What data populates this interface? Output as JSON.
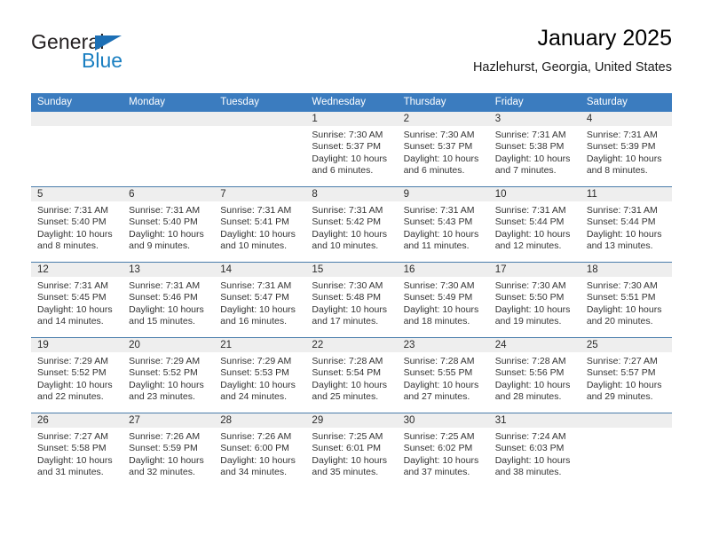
{
  "brand": {
    "name_part1": "General",
    "name_part2": "Blue",
    "accent_color": "#1c6fb5",
    "text_color": "#231f20"
  },
  "header": {
    "title": "January 2025",
    "location": "Hazlehurst, Georgia, United States"
  },
  "theme": {
    "header_row_bg": "#3b7cbf",
    "daynum_band_bg": "#eeeeee",
    "row_separator": "#4a7dab"
  },
  "weekday_headers": [
    "Sunday",
    "Monday",
    "Tuesday",
    "Wednesday",
    "Thursday",
    "Friday",
    "Saturday"
  ],
  "weeks": [
    [
      {
        "day": "",
        "sunrise": "",
        "sunset": "",
        "daylight_line1": "",
        "daylight_line2": "",
        "empty": true
      },
      {
        "day": "",
        "sunrise": "",
        "sunset": "",
        "daylight_line1": "",
        "daylight_line2": "",
        "empty": true
      },
      {
        "day": "",
        "sunrise": "",
        "sunset": "",
        "daylight_line1": "",
        "daylight_line2": "",
        "empty": true
      },
      {
        "day": "1",
        "sunrise": "Sunrise: 7:30 AM",
        "sunset": "Sunset: 5:37 PM",
        "daylight_line1": "Daylight: 10 hours",
        "daylight_line2": "and 6 minutes."
      },
      {
        "day": "2",
        "sunrise": "Sunrise: 7:30 AM",
        "sunset": "Sunset: 5:37 PM",
        "daylight_line1": "Daylight: 10 hours",
        "daylight_line2": "and 6 minutes."
      },
      {
        "day": "3",
        "sunrise": "Sunrise: 7:31 AM",
        "sunset": "Sunset: 5:38 PM",
        "daylight_line1": "Daylight: 10 hours",
        "daylight_line2": "and 7 minutes."
      },
      {
        "day": "4",
        "sunrise": "Sunrise: 7:31 AM",
        "sunset": "Sunset: 5:39 PM",
        "daylight_line1": "Daylight: 10 hours",
        "daylight_line2": "and 8 minutes."
      }
    ],
    [
      {
        "day": "5",
        "sunrise": "Sunrise: 7:31 AM",
        "sunset": "Sunset: 5:40 PM",
        "daylight_line1": "Daylight: 10 hours",
        "daylight_line2": "and 8 minutes."
      },
      {
        "day": "6",
        "sunrise": "Sunrise: 7:31 AM",
        "sunset": "Sunset: 5:40 PM",
        "daylight_line1": "Daylight: 10 hours",
        "daylight_line2": "and 9 minutes."
      },
      {
        "day": "7",
        "sunrise": "Sunrise: 7:31 AM",
        "sunset": "Sunset: 5:41 PM",
        "daylight_line1": "Daylight: 10 hours",
        "daylight_line2": "and 10 minutes."
      },
      {
        "day": "8",
        "sunrise": "Sunrise: 7:31 AM",
        "sunset": "Sunset: 5:42 PM",
        "daylight_line1": "Daylight: 10 hours",
        "daylight_line2": "and 10 minutes."
      },
      {
        "day": "9",
        "sunrise": "Sunrise: 7:31 AM",
        "sunset": "Sunset: 5:43 PM",
        "daylight_line1": "Daylight: 10 hours",
        "daylight_line2": "and 11 minutes."
      },
      {
        "day": "10",
        "sunrise": "Sunrise: 7:31 AM",
        "sunset": "Sunset: 5:44 PM",
        "daylight_line1": "Daylight: 10 hours",
        "daylight_line2": "and 12 minutes."
      },
      {
        "day": "11",
        "sunrise": "Sunrise: 7:31 AM",
        "sunset": "Sunset: 5:44 PM",
        "daylight_line1": "Daylight: 10 hours",
        "daylight_line2": "and 13 minutes."
      }
    ],
    [
      {
        "day": "12",
        "sunrise": "Sunrise: 7:31 AM",
        "sunset": "Sunset: 5:45 PM",
        "daylight_line1": "Daylight: 10 hours",
        "daylight_line2": "and 14 minutes."
      },
      {
        "day": "13",
        "sunrise": "Sunrise: 7:31 AM",
        "sunset": "Sunset: 5:46 PM",
        "daylight_line1": "Daylight: 10 hours",
        "daylight_line2": "and 15 minutes."
      },
      {
        "day": "14",
        "sunrise": "Sunrise: 7:31 AM",
        "sunset": "Sunset: 5:47 PM",
        "daylight_line1": "Daylight: 10 hours",
        "daylight_line2": "and 16 minutes."
      },
      {
        "day": "15",
        "sunrise": "Sunrise: 7:30 AM",
        "sunset": "Sunset: 5:48 PM",
        "daylight_line1": "Daylight: 10 hours",
        "daylight_line2": "and 17 minutes."
      },
      {
        "day": "16",
        "sunrise": "Sunrise: 7:30 AM",
        "sunset": "Sunset: 5:49 PM",
        "daylight_line1": "Daylight: 10 hours",
        "daylight_line2": "and 18 minutes."
      },
      {
        "day": "17",
        "sunrise": "Sunrise: 7:30 AM",
        "sunset": "Sunset: 5:50 PM",
        "daylight_line1": "Daylight: 10 hours",
        "daylight_line2": "and 19 minutes."
      },
      {
        "day": "18",
        "sunrise": "Sunrise: 7:30 AM",
        "sunset": "Sunset: 5:51 PM",
        "daylight_line1": "Daylight: 10 hours",
        "daylight_line2": "and 20 minutes."
      }
    ],
    [
      {
        "day": "19",
        "sunrise": "Sunrise: 7:29 AM",
        "sunset": "Sunset: 5:52 PM",
        "daylight_line1": "Daylight: 10 hours",
        "daylight_line2": "and 22 minutes."
      },
      {
        "day": "20",
        "sunrise": "Sunrise: 7:29 AM",
        "sunset": "Sunset: 5:52 PM",
        "daylight_line1": "Daylight: 10 hours",
        "daylight_line2": "and 23 minutes."
      },
      {
        "day": "21",
        "sunrise": "Sunrise: 7:29 AM",
        "sunset": "Sunset: 5:53 PM",
        "daylight_line1": "Daylight: 10 hours",
        "daylight_line2": "and 24 minutes."
      },
      {
        "day": "22",
        "sunrise": "Sunrise: 7:28 AM",
        "sunset": "Sunset: 5:54 PM",
        "daylight_line1": "Daylight: 10 hours",
        "daylight_line2": "and 25 minutes."
      },
      {
        "day": "23",
        "sunrise": "Sunrise: 7:28 AM",
        "sunset": "Sunset: 5:55 PM",
        "daylight_line1": "Daylight: 10 hours",
        "daylight_line2": "and 27 minutes."
      },
      {
        "day": "24",
        "sunrise": "Sunrise: 7:28 AM",
        "sunset": "Sunset: 5:56 PM",
        "daylight_line1": "Daylight: 10 hours",
        "daylight_line2": "and 28 minutes."
      },
      {
        "day": "25",
        "sunrise": "Sunrise: 7:27 AM",
        "sunset": "Sunset: 5:57 PM",
        "daylight_line1": "Daylight: 10 hours",
        "daylight_line2": "and 29 minutes."
      }
    ],
    [
      {
        "day": "26",
        "sunrise": "Sunrise: 7:27 AM",
        "sunset": "Sunset: 5:58 PM",
        "daylight_line1": "Daylight: 10 hours",
        "daylight_line2": "and 31 minutes."
      },
      {
        "day": "27",
        "sunrise": "Sunrise: 7:26 AM",
        "sunset": "Sunset: 5:59 PM",
        "daylight_line1": "Daylight: 10 hours",
        "daylight_line2": "and 32 minutes."
      },
      {
        "day": "28",
        "sunrise": "Sunrise: 7:26 AM",
        "sunset": "Sunset: 6:00 PM",
        "daylight_line1": "Daylight: 10 hours",
        "daylight_line2": "and 34 minutes."
      },
      {
        "day": "29",
        "sunrise": "Sunrise: 7:25 AM",
        "sunset": "Sunset: 6:01 PM",
        "daylight_line1": "Daylight: 10 hours",
        "daylight_line2": "and 35 minutes."
      },
      {
        "day": "30",
        "sunrise": "Sunrise: 7:25 AM",
        "sunset": "Sunset: 6:02 PM",
        "daylight_line1": "Daylight: 10 hours",
        "daylight_line2": "and 37 minutes."
      },
      {
        "day": "31",
        "sunrise": "Sunrise: 7:24 AM",
        "sunset": "Sunset: 6:03 PM",
        "daylight_line1": "Daylight: 10 hours",
        "daylight_line2": "and 38 minutes."
      },
      {
        "day": "",
        "sunrise": "",
        "sunset": "",
        "daylight_line1": "",
        "daylight_line2": "",
        "empty": true
      }
    ]
  ]
}
